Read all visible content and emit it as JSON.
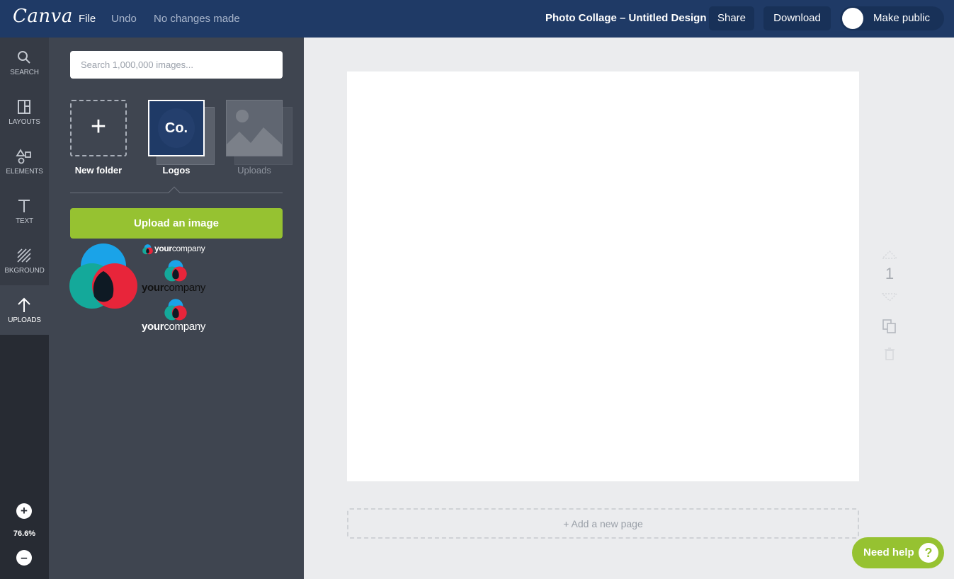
{
  "topbar": {
    "logo": "Canva",
    "file": "File",
    "undo": "Undo",
    "status": "No changes made",
    "design_title": "Photo Collage – Untitled Design",
    "share": "Share",
    "download": "Download",
    "make_public": "Make public"
  },
  "rail": {
    "items": [
      {
        "label": "SEARCH",
        "icon": "search-icon"
      },
      {
        "label": "LAYOUTS",
        "icon": "layouts-icon"
      },
      {
        "label": "ELEMENTS",
        "icon": "elements-icon"
      },
      {
        "label": "TEXT",
        "icon": "text-icon"
      },
      {
        "label": "BKGROUND",
        "icon": "background-icon"
      },
      {
        "label": "UPLOADS",
        "icon": "upload-arrow-icon",
        "active": true
      }
    ],
    "zoom_in": "+",
    "zoom_level": "76.6%",
    "zoom_out": "–"
  },
  "panel": {
    "search_placeholder": "Search 1,000,000 images...",
    "folders": [
      {
        "label": "New folder",
        "icon": "plus-icon"
      },
      {
        "label": "Logos",
        "thumb_text": "Co."
      },
      {
        "label": "Uploads",
        "icon": "image-placeholder-icon"
      }
    ],
    "upload_button": "Upload an image",
    "logo_word_regular": "your",
    "logo_word_rest": "company"
  },
  "canvas": {
    "page_number": "1",
    "add_page": "+ Add a new page"
  },
  "help": {
    "label": "Need help",
    "icon": "?"
  },
  "colors": {
    "topbar": "#1f3a66",
    "accent_green": "#96c231",
    "panel": "#3f4550",
    "rail": "#272b33",
    "logo_blue": "#1aa3e8",
    "logo_teal": "#14a99a",
    "logo_red": "#e8253a"
  }
}
